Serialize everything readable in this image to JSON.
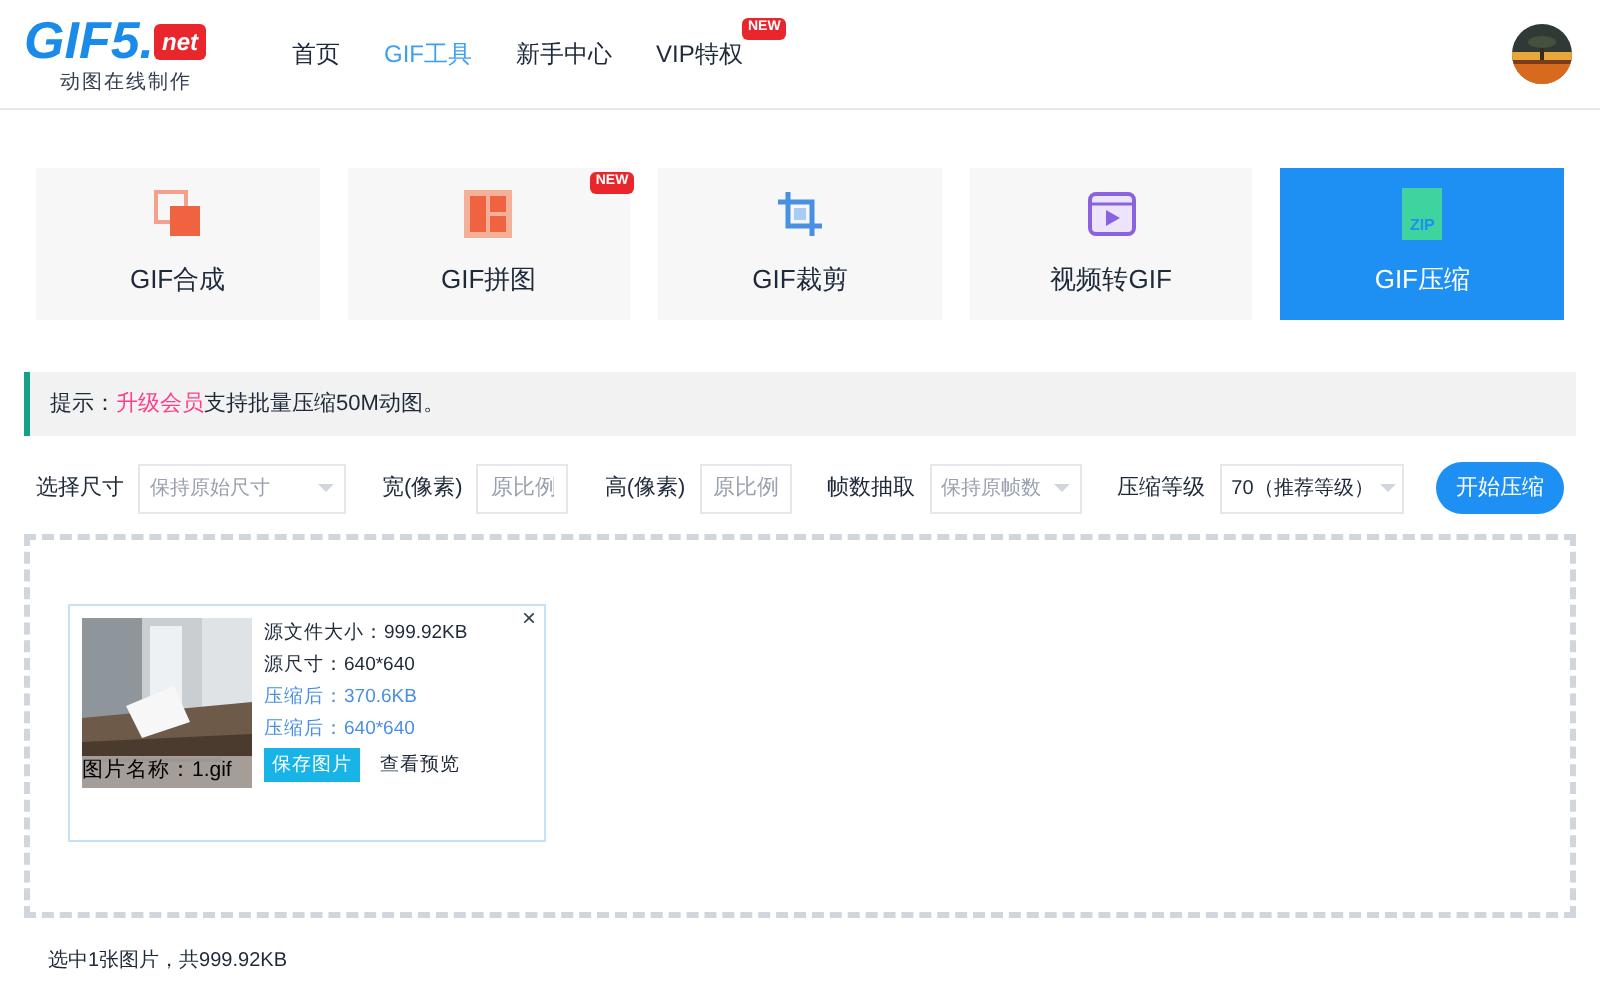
{
  "header": {
    "logo": {
      "text": "GIF5.",
      "badge": "net",
      "tagline": "动图在线制作"
    },
    "nav": [
      {
        "label": "首页",
        "selected": false
      },
      {
        "label": "GIF工具",
        "selected": true
      },
      {
        "label": "新手中心",
        "selected": false
      },
      {
        "label": "VIP特权",
        "selected": false,
        "badge": "NEW"
      }
    ]
  },
  "tools": [
    {
      "kind": "compose",
      "label": "GIF合成",
      "selected": false
    },
    {
      "kind": "collage",
      "label": "GIF拼图",
      "selected": false,
      "badge": "NEW"
    },
    {
      "kind": "crop",
      "label": "GIF裁剪",
      "selected": false
    },
    {
      "kind": "video",
      "label": "视频转GIF",
      "selected": false
    },
    {
      "kind": "zip",
      "label": "GIF压缩",
      "selected": true,
      "icon_text": "ZIP"
    }
  ],
  "notice": {
    "prefix": "提示：",
    "link": "升级会员",
    "rest": "支持批量压缩50M动图。"
  },
  "options": [
    {
      "kind": "select",
      "label": "选择尺寸",
      "placeholder": "保持原始尺寸"
    },
    {
      "kind": "input",
      "label": "宽(像素)",
      "placeholder": "原比例"
    },
    {
      "kind": "input",
      "label": "高(像素)",
      "placeholder": "原比例"
    },
    {
      "kind": "select",
      "label": "帧数抽取",
      "placeholder": "保持原帧数"
    },
    {
      "kind": "select",
      "label": "压缩等级",
      "value": "70（推荐等级）"
    }
  ],
  "start_button": "开始压缩",
  "files": [
    {
      "name": "图片名称：1.gif",
      "close": "×",
      "details": [
        {
          "text": "源文件大小：999.92KB",
          "compressed": false
        },
        {
          "text": "源尺寸：640*640",
          "compressed": false
        },
        {
          "text": "压缩后：370.6KB",
          "compressed": true
        },
        {
          "text": "压缩后：640*640",
          "compressed": true
        }
      ],
      "save_button": "保存图片",
      "preview_link": "查看预览"
    }
  ],
  "status": "选中1张图片，共999.92KB"
}
